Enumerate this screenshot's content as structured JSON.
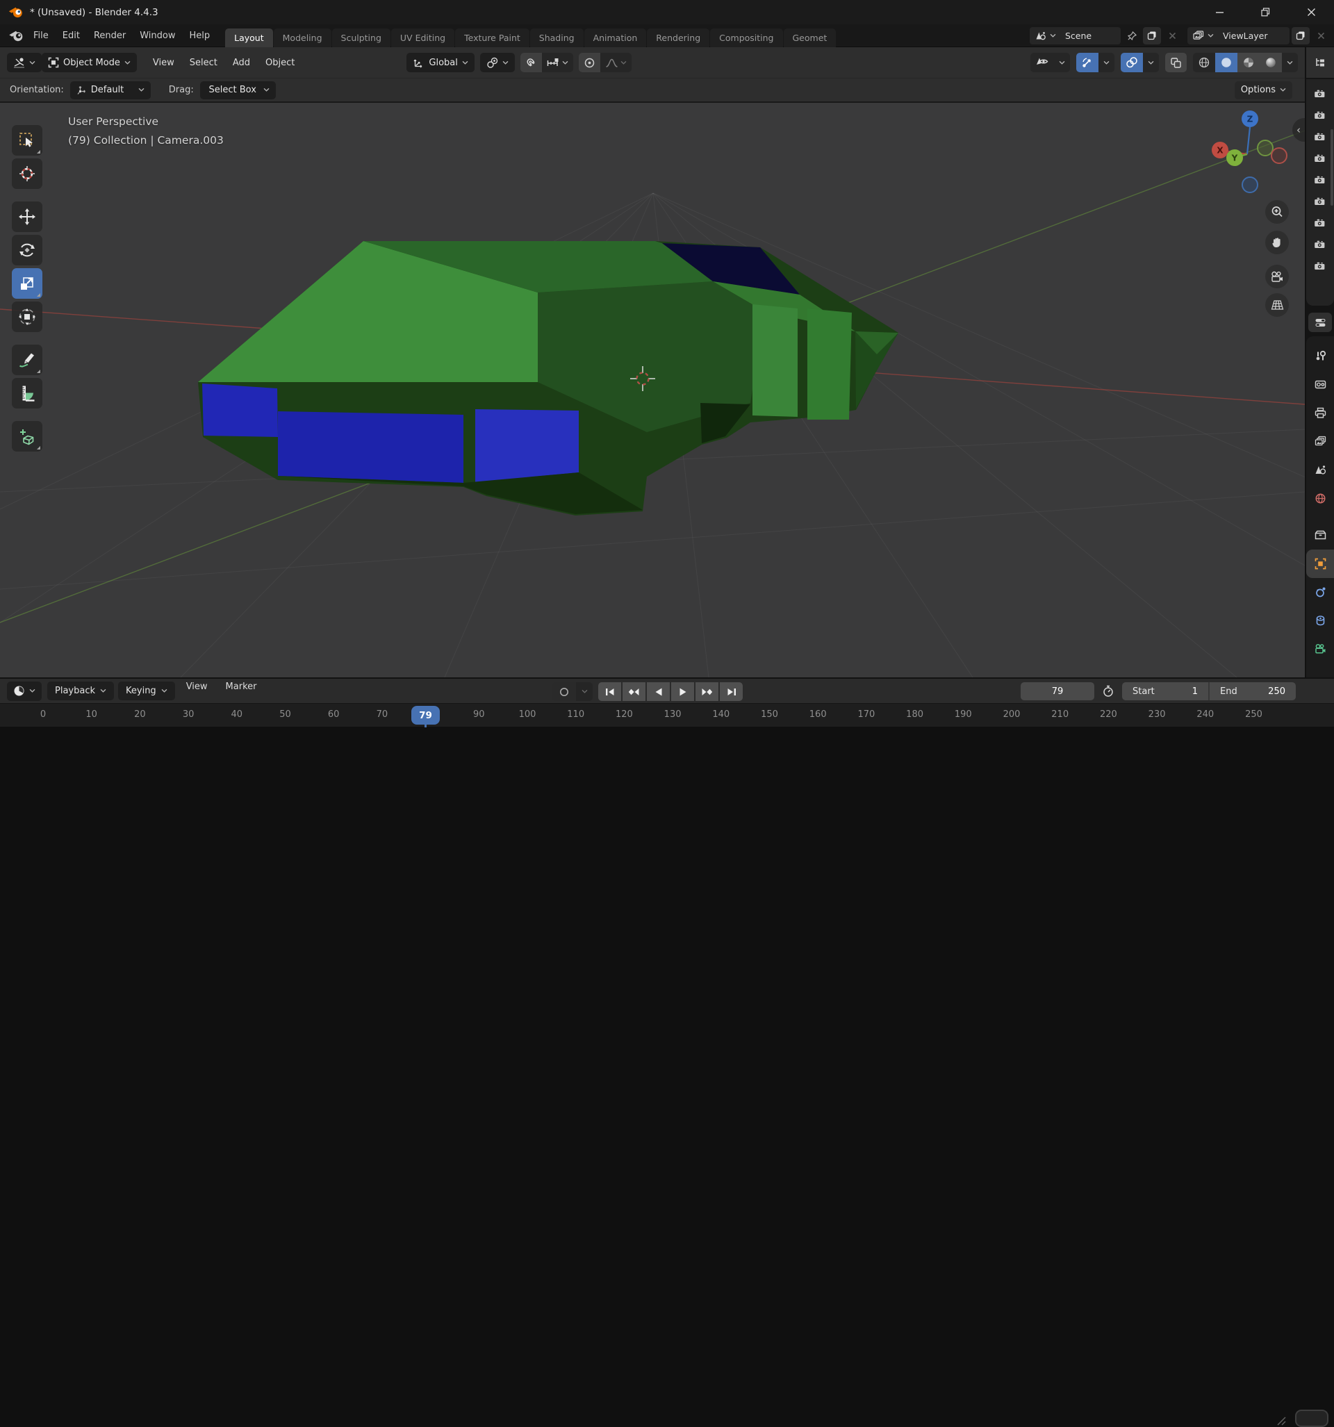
{
  "window": {
    "title": "* (Unsaved) - Blender 4.4.3"
  },
  "topbar": {
    "menus": [
      "File",
      "Edit",
      "Render",
      "Window",
      "Help"
    ],
    "workspaces": [
      "Layout",
      "Modeling",
      "Sculpting",
      "UV Editing",
      "Texture Paint",
      "Shading",
      "Animation",
      "Rendering",
      "Compositing",
      "Geomet"
    ],
    "active_workspace": "Layout",
    "scene_label": "Scene",
    "view_layer_label": "ViewLayer"
  },
  "viewport_header": {
    "mode_label": "Object Mode",
    "menus": [
      "View",
      "Select",
      "Add",
      "Object"
    ],
    "orientation_label": "Global"
  },
  "tool_settings": {
    "orientation_label": "Orientation:",
    "orientation_value": "Default",
    "drag_label": "Drag:",
    "drag_value": "Select Box",
    "options_label": "Options"
  },
  "viewport": {
    "overlay_line1": "User Perspective",
    "overlay_line2": "(79) Collection | Camera.003",
    "axis_labels": {
      "x": "X",
      "y": "Y",
      "z": "Z"
    }
  },
  "left_toolbar": {
    "tools": [
      {
        "id": "select-box",
        "corner": true
      },
      {
        "id": "cursor"
      },
      {
        "id": "move",
        "group": true
      },
      {
        "id": "rotate"
      },
      {
        "id": "scale",
        "active": true,
        "corner": true
      },
      {
        "id": "transform"
      },
      {
        "id": "annotate",
        "group": true,
        "corner": true
      },
      {
        "id": "measure"
      },
      {
        "id": "add-cube",
        "group": true,
        "corner": true
      }
    ]
  },
  "right_rail": {
    "outliner_camera_count": 9,
    "properties_tabs": [
      {
        "id": "tool"
      },
      {
        "id": "render"
      },
      {
        "id": "output"
      },
      {
        "id": "view-layer"
      },
      {
        "id": "scene"
      },
      {
        "id": "world"
      },
      {
        "id": "collection",
        "gap": true
      },
      {
        "id": "object",
        "active": true
      },
      {
        "id": "physics"
      },
      {
        "id": "constraints"
      },
      {
        "id": "object-data"
      }
    ]
  },
  "timeline": {
    "menus": [
      {
        "label": "Playback",
        "dropdown": true
      },
      {
        "label": "Keying",
        "dropdown": true
      },
      {
        "label": "View",
        "dropdown": false
      },
      {
        "label": "Marker",
        "dropdown": false
      }
    ],
    "transport": [
      "jump-to-start",
      "previous-keyframe",
      "play-reverse",
      "play",
      "next-keyframe",
      "jump-to-end"
    ],
    "current_frame": "79",
    "start_label": "Start",
    "start_value": "1",
    "end_label": "End",
    "end_value": "250",
    "ruler_labels": [
      0,
      10,
      20,
      30,
      40,
      50,
      60,
      70,
      90,
      100,
      110,
      120,
      130,
      140,
      150,
      160,
      170,
      180,
      190,
      200,
      210,
      220,
      230,
      240,
      250
    ]
  },
  "colors": {
    "accent_blue": "#4772b3",
    "axis_x_red": "#b8453e",
    "axis_y_green": "#71a83b",
    "axis_z_blue": "#3a6fb8",
    "car_body_green": "#2f7c2e",
    "car_window_blue": "#2127b8",
    "object_orange": "#ef9d3c"
  }
}
